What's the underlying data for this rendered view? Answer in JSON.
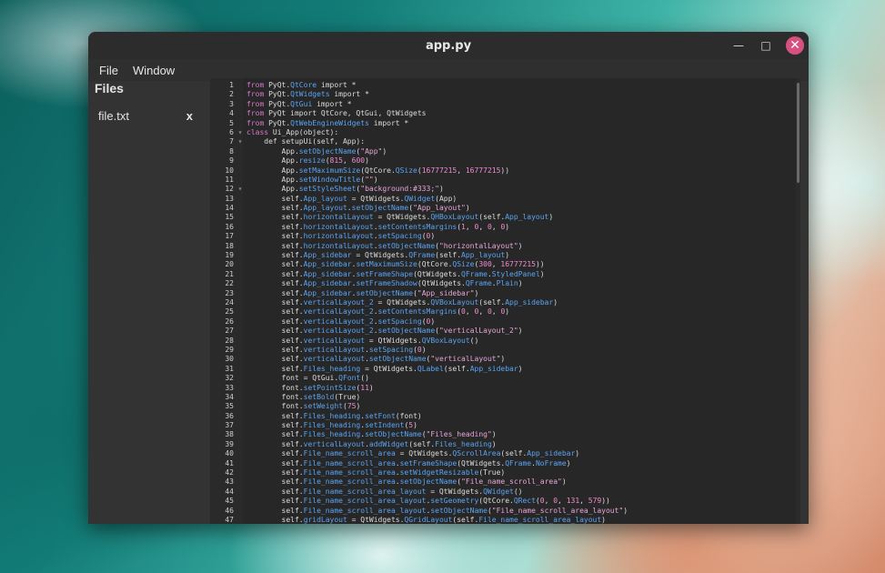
{
  "window": {
    "title": "app.py",
    "minimize_icon": "minimize-icon",
    "maximize_icon": "maximize-icon",
    "close_icon": "close-icon",
    "close_color": "#d6517f"
  },
  "menu": {
    "file": "File",
    "window": "Window"
  },
  "sidebar": {
    "heading": "Files",
    "files": [
      {
        "name": "file.txt",
        "close": "x"
      }
    ]
  },
  "editor": {
    "lines": [
      "from PyQt5.QtCore import *",
      "from PyQt5.QtWidgets import *",
      "from PyQt5.QtGui import *",
      "from PyQt5 import QtCore, QtGui, QtWidgets",
      "from PyQt5.QtWebEngineWidgets import *",
      "class Ui_App(object):",
      "    def setupUi(self, App):",
      "        App.setObjectName(\"App\")",
      "        App.resize(815, 600)",
      "        App.setMaximumSize(QtCore.QSize(16777215, 16777215))",
      "        App.setWindowTitle(\"\")",
      "        App.setStyleSheet(\"background:#333;\")",
      "        self.App_layout = QtWidgets.QWidget(App)",
      "        self.App_layout.setObjectName(\"App_layout\")",
      "        self.horizontalLayout = QtWidgets.QHBoxLayout(self.App_layout)",
      "        self.horizontalLayout.setContentsMargins(1, 0, 0, 0)",
      "        self.horizontalLayout.setSpacing(0)",
      "        self.horizontalLayout.setObjectName(\"horizontalLayout\")",
      "        self.App_sidebar = QtWidgets.QFrame(self.App_layout)",
      "        self.App_sidebar.setMaximumSize(QtCore.QSize(300, 16777215))",
      "        self.App_sidebar.setFrameShape(QtWidgets.QFrame.StyledPanel)",
      "        self.App_sidebar.setFrameShadow(QtWidgets.QFrame.Plain)",
      "        self.App_sidebar.setObjectName(\"App_sidebar\")",
      "        self.verticalLayout_2 = QtWidgets.QVBoxLayout(self.App_sidebar)",
      "        self.verticalLayout_2.setContentsMargins(0, 0, 0, 0)",
      "        self.verticalLayout_2.setSpacing(0)",
      "        self.verticalLayout_2.setObjectName(\"verticalLayout_2\")",
      "        self.verticalLayout = QtWidgets.QVBoxLayout()",
      "        self.verticalLayout.setSpacing(0)",
      "        self.verticalLayout.setObjectName(\"verticalLayout\")",
      "        self.Files_heading = QtWidgets.QLabel(self.App_sidebar)",
      "        font = QtGui.QFont()",
      "        font.setPointSize(11)",
      "        font.setBold(True)",
      "        font.setWeight(75)",
      "        self.Files_heading.setFont(font)",
      "        self.Files_heading.setIndent(5)",
      "        self.Files_heading.setObjectName(\"Files_heading\")",
      "        self.verticalLayout.addWidget(self.Files_heading)",
      "        self.File_name_scroll_area = QtWidgets.QScrollArea(self.App_sidebar)",
      "        self.File_name_scroll_area.setFrameShape(QtWidgets.QFrame.NoFrame)",
      "        self.File_name_scroll_area.setWidgetResizable(True)",
      "        self.File_name_scroll_area.setObjectName(\"File_name_scroll_area\")",
      "        self.File_name_scroll_area_layout = QtWidgets.QWidget()",
      "        self.File_name_scroll_area_layout.setGeometry(QtCore.QRect(0, 0, 131, 579))",
      "        self.File_name_scroll_area_layout.setObjectName(\"File_name_scroll_area_layout\")",
      "        self.gridLayout = QtWidgets.QGridLayout(self.File_name_scroll_area_layout)"
    ],
    "fold_lines": [
      6,
      7,
      12
    ]
  }
}
